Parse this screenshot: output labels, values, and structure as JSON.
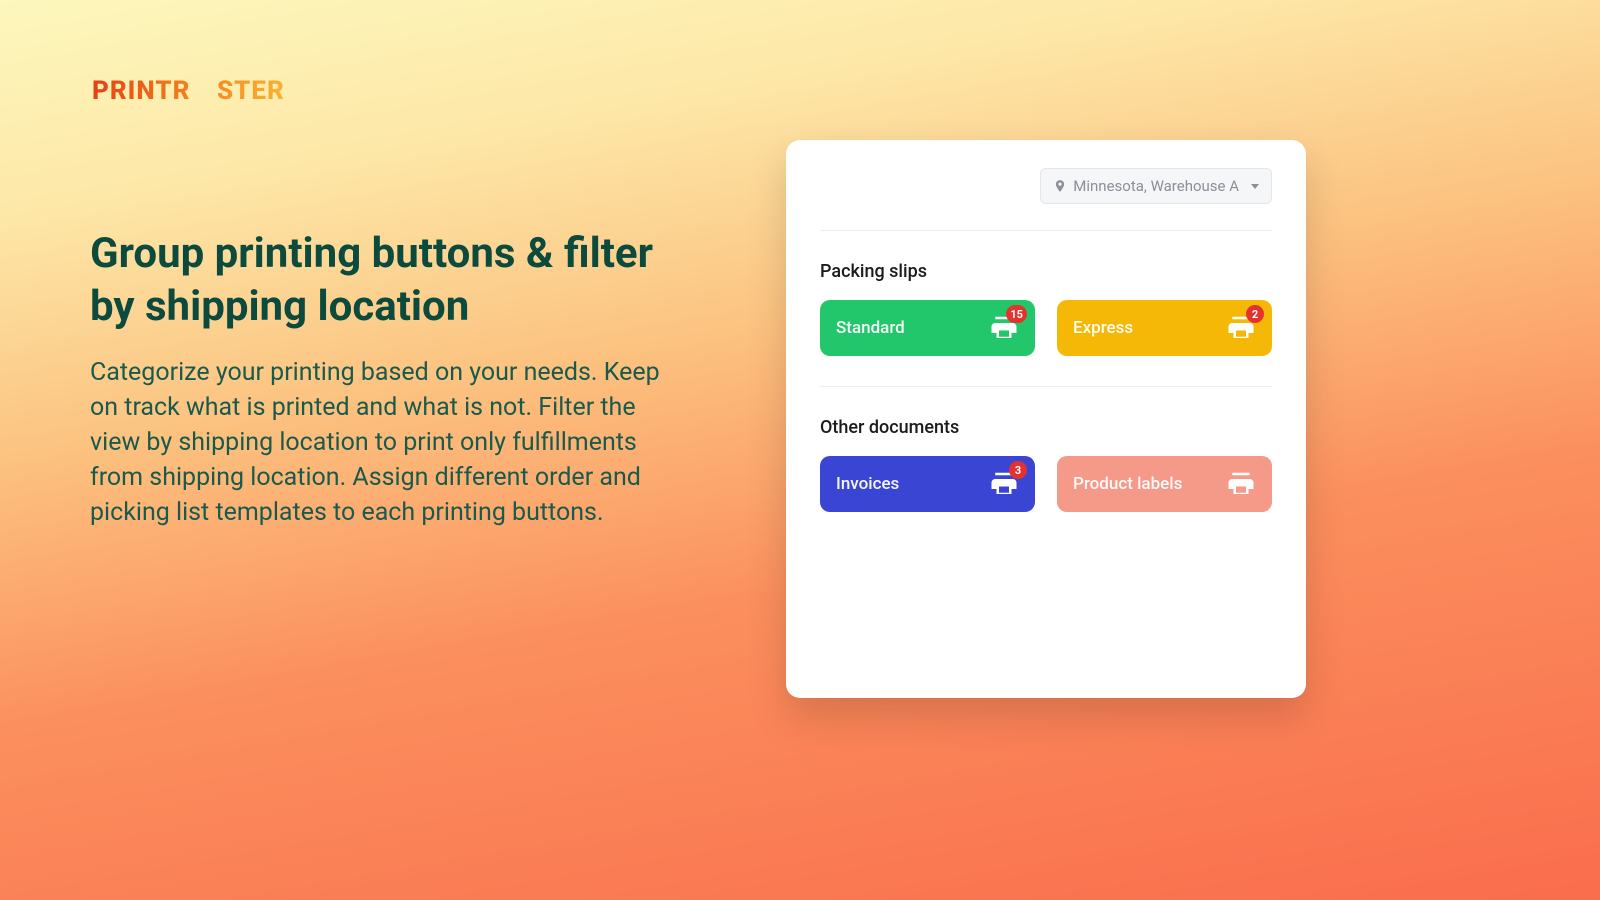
{
  "brand": {
    "part1": "PRINTR",
    "infinity": "∞",
    "part2": "STER"
  },
  "hero": {
    "title": "Group printing buttons & filter by shipping location",
    "body": "Categorize your printing based on your needs. Keep on track what is printed and what is not. Filter the view by shipping location to print only fulfillments from shipping location. Assign different order and picking list templates to each printing buttons."
  },
  "card": {
    "location": "Minnesota, Warehouse A",
    "sections": [
      {
        "title": "Packing slips",
        "buttons": [
          {
            "label": "Standard",
            "color": "c-green",
            "badge": "15"
          },
          {
            "label": "Express",
            "color": "c-amber",
            "badge": "2"
          }
        ]
      },
      {
        "title": "Other documents",
        "buttons": [
          {
            "label": "Invoices",
            "color": "c-indigo",
            "badge": "3"
          },
          {
            "label": "Product labels",
            "color": "c-salmon",
            "badge": null
          }
        ]
      }
    ]
  }
}
